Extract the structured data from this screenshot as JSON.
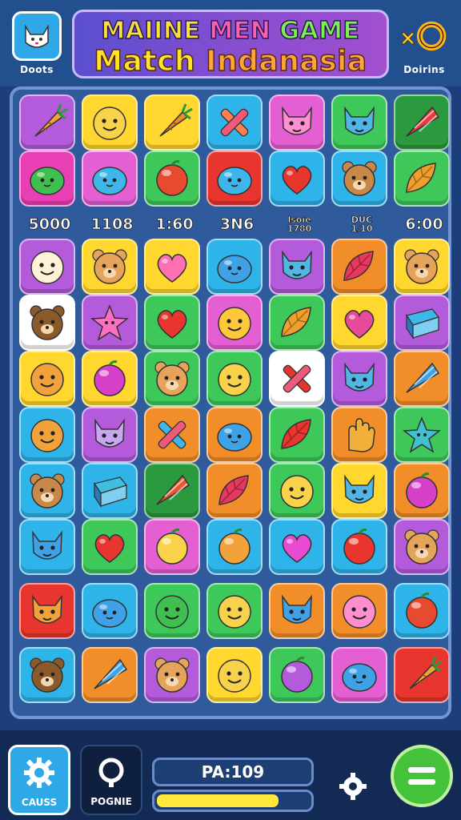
{
  "header": {
    "left_button_label": "Doots",
    "right_button_label": "Doirins",
    "title_line1": [
      "MAIINE",
      "MEN",
      "GAME"
    ],
    "title_line2": [
      "Match",
      "Indanasia"
    ]
  },
  "board": {
    "score_strip": [
      "5000",
      "1108",
      "1:60",
      "3N6",
      "",
      "",
      "6:00"
    ],
    "score_strip_small": [
      {
        "a": "lsoie",
        "b": "1780"
      },
      {
        "a": "DUC",
        "b": "1/10"
      }
    ],
    "mini_note": "",
    "rows": [
      [
        {
          "bg": "#b45bdc",
          "icon": "carrot",
          "color": "#f2a23a",
          "name": "carrot-piece"
        },
        {
          "bg": "#ffd72e",
          "icon": "face",
          "color": "#f7d24a",
          "name": "yellow-face-piece"
        },
        {
          "bg": "#ffd72e",
          "icon": "carrot",
          "color": "#f08a2a",
          "name": "carrot-piece"
        },
        {
          "bg": "#2fb4ea",
          "icon": "cross",
          "color": "#ff7f50",
          "name": "crossed-sticks-piece"
        },
        {
          "bg": "#e45fd2",
          "icon": "cat",
          "color": "#ff8fd1",
          "name": "pink-cat-piece"
        },
        {
          "bg": "#3fc85a",
          "icon": "cat",
          "color": "#4fb6e6",
          "name": "blue-cat-piece"
        },
        {
          "bg": "#2b9a3f",
          "icon": "cone",
          "color": "#e8383f",
          "name": "cone-piece"
        }
      ],
      [
        {
          "bg": "#e83fb4",
          "icon": "blob",
          "color": "#3fbf4f",
          "name": "green-blob-piece"
        },
        {
          "bg": "#e45fd2",
          "icon": "blob",
          "color": "#3fb6ea",
          "name": "blue-blob-piece"
        },
        {
          "bg": "#3fc85a",
          "icon": "ball",
          "color": "#e84a2f",
          "name": "red-ball-piece"
        },
        {
          "bg": "#e8362f",
          "icon": "blob",
          "color": "#3fb6ea",
          "name": "blue-blob-piece"
        },
        {
          "bg": "#2fb4ea",
          "icon": "heart",
          "color": "#e8362f",
          "name": "red-heart-piece"
        },
        {
          "bg": "#2fb4ea",
          "icon": "bear",
          "color": "#c8884a",
          "name": "bear-piece"
        },
        {
          "bg": "#3fc85a",
          "icon": "leaf",
          "color": "#f0a02a",
          "name": "orange-leaf-piece"
        }
      ],
      [
        {
          "bg": "#b45bdc",
          "icon": "face",
          "color": "#fff1d8",
          "name": "white-face-piece"
        },
        {
          "bg": "#ffd72e",
          "icon": "bear",
          "color": "#e6a45a",
          "name": "bear-piece"
        },
        {
          "bg": "#ffd72e",
          "icon": "heart",
          "color": "#ff6fb4",
          "name": "pink-heart-piece"
        },
        {
          "bg": "#2fb4ea",
          "icon": "blob",
          "color": "#3fa2e6",
          "name": "blue-drop-piece"
        },
        {
          "bg": "#b45bdc",
          "icon": "cat",
          "color": "#4fb6e6",
          "name": "blue-cat-piece"
        },
        {
          "bg": "#f28e2a",
          "icon": "leaf",
          "color": "#e8385f",
          "name": "pink-leaf-piece"
        },
        {
          "bg": "#ffd72e",
          "icon": "bear",
          "color": "#e6a45a",
          "name": "bear-piece"
        }
      ],
      [
        {
          "bg": "#ffffff",
          "icon": "bear",
          "color": "#8b5a2b",
          "name": "brown-bear-piece"
        },
        {
          "bg": "#b45bdc",
          "icon": "star",
          "color": "#ff6fc1",
          "name": "pink-star-piece"
        },
        {
          "bg": "#3fc85a",
          "icon": "heart",
          "color": "#e8362f",
          "name": "red-heart-piece"
        },
        {
          "bg": "#e45fd2",
          "icon": "face",
          "color": "#ffc83a",
          "name": "yellow-face-piece"
        },
        {
          "bg": "#3fc85a",
          "icon": "leaf",
          "color": "#f0a02a",
          "name": "orange-leaf-piece"
        },
        {
          "bg": "#ffd72e",
          "icon": "heart",
          "color": "#e84a9a",
          "name": "pink-heart-piece"
        },
        {
          "bg": "#b45bdc",
          "icon": "box",
          "color": "#3fb6ea",
          "name": "box-piece"
        }
      ],
      [
        {
          "bg": "#ffd72e",
          "icon": "face",
          "color": "#f2a23a",
          "name": "orange-face-piece"
        },
        {
          "bg": "#ffd72e",
          "icon": "ball",
          "color": "#d63fc8",
          "name": "purple-ball-piece"
        },
        {
          "bg": "#3fc85a",
          "icon": "bear",
          "color": "#e6a45a",
          "name": "bear-piece"
        },
        {
          "bg": "#3fc85a",
          "icon": "face",
          "color": "#f7d24a",
          "name": "yellow-face-piece"
        },
        {
          "bg": "#ffffff",
          "icon": "cross",
          "color": "#e8362f",
          "name": "crossed-sticks-piece"
        },
        {
          "bg": "#b45bdc",
          "icon": "cat",
          "color": "#4fb6e6",
          "name": "blue-cat-piece"
        },
        {
          "bg": "#f28e2a",
          "icon": "cone",
          "color": "#3fa2e6",
          "name": "cone-piece"
        }
      ],
      [
        {
          "bg": "#2fb4ea",
          "icon": "face",
          "color": "#f2a23a",
          "name": "orange-face-piece"
        },
        {
          "bg": "#b45bdc",
          "icon": "cat",
          "color": "#c9a6f0",
          "name": "purple-cat-piece"
        },
        {
          "bg": "#f28e2a",
          "icon": "cross",
          "color": "#3fb6ea",
          "name": "crossed-sticks-piece"
        },
        {
          "bg": "#f28e2a",
          "icon": "blob",
          "color": "#3fa2e6",
          "name": "blue-drop-piece"
        },
        {
          "bg": "#3fc85a",
          "icon": "leaf",
          "color": "#e8362f",
          "name": "red-leaf-piece"
        },
        {
          "bg": "#f28e2a",
          "icon": "hand",
          "color": "#f2b03a",
          "name": "hand-piece"
        },
        {
          "bg": "#3fc85a",
          "icon": "star",
          "color": "#3fbfd0",
          "name": "teal-star-piece"
        }
      ],
      [
        {
          "bg": "#2fb4ea",
          "icon": "bear",
          "color": "#c8884a",
          "name": "bear-piece"
        },
        {
          "bg": "#2fb4ea",
          "icon": "box",
          "color": "#3fbfe0",
          "name": "box-piece"
        },
        {
          "bg": "#2b9a3f",
          "icon": "cone",
          "color": "#e8562f",
          "name": "cone-piece"
        },
        {
          "bg": "#f28e2a",
          "icon": "leaf",
          "color": "#e8385f",
          "name": "pink-leaf-piece"
        },
        {
          "bg": "#3fc85a",
          "icon": "face",
          "color": "#f7d24a",
          "name": "yellow-face-piece"
        },
        {
          "bg": "#ffd72e",
          "icon": "cat",
          "color": "#4fb6e6",
          "name": "blue-cat-piece"
        },
        {
          "bg": "#f28e2a",
          "icon": "ball",
          "color": "#d63fc8",
          "name": "purple-ball-piece"
        }
      ],
      [
        {
          "bg": "#2fb4ea",
          "icon": "cat",
          "color": "#3fa2e6",
          "name": "blue-cat-piece"
        },
        {
          "bg": "#3fc85a",
          "icon": "heart",
          "color": "#e8362f",
          "name": "red-heart-piece"
        },
        {
          "bg": "#e45fd2",
          "icon": "ball",
          "color": "#f7d24a",
          "name": "yellow-ball-piece"
        },
        {
          "bg": "#2fb4ea",
          "icon": "ball",
          "color": "#f2a23a",
          "name": "orange-ball-piece"
        },
        {
          "bg": "#2fb4ea",
          "icon": "heart",
          "color": "#e84ad2",
          "name": "pink-heart-piece"
        },
        {
          "bg": "#2fb4ea",
          "icon": "ball",
          "color": "#e8362f",
          "name": "red-ball-piece"
        },
        {
          "bg": "#b45bdc",
          "icon": "bear",
          "color": "#e6a45a",
          "name": "bear-piece"
        }
      ],
      [
        {
          "bg": "#e8362f",
          "icon": "cat",
          "color": "#f2a23a",
          "name": "orange-cat-piece"
        },
        {
          "bg": "#2fb4ea",
          "icon": "blob",
          "color": "#3fa2e6",
          "name": "blue-blob-piece"
        },
        {
          "bg": "#3fc85a",
          "icon": "face",
          "color": "#3fbf4f",
          "name": "green-face-piece"
        },
        {
          "bg": "#3fc85a",
          "icon": "face",
          "color": "#f7d24a",
          "name": "yellow-face-piece"
        },
        {
          "bg": "#f28e2a",
          "icon": "cat",
          "color": "#3fa2e6",
          "name": "blue-cat-piece"
        },
        {
          "bg": "#f28e2a",
          "icon": "face",
          "color": "#ff8fd1",
          "name": "pink-face-piece"
        },
        {
          "bg": "#2fb4ea",
          "icon": "ball",
          "color": "#e84a2f",
          "name": "red-ball-piece"
        }
      ],
      [
        {
          "bg": "#2fb4ea",
          "icon": "bear",
          "color": "#8b5a2b",
          "name": "brown-bear-piece"
        },
        {
          "bg": "#f28e2a",
          "icon": "cone",
          "color": "#3fa2e6",
          "name": "cone-piece"
        },
        {
          "bg": "#b45bdc",
          "icon": "bear",
          "color": "#e6a45a",
          "name": "bear-piece"
        },
        {
          "bg": "#ffd72e",
          "icon": "face",
          "color": "#f7d24a",
          "name": "yellow-face-piece"
        },
        {
          "bg": "#3fc85a",
          "icon": "ball",
          "color": "#b45bdc",
          "name": "purple-ball-piece"
        },
        {
          "bg": "#e45fd2",
          "icon": "blob",
          "color": "#3fa2e6",
          "name": "blue-blob-piece"
        },
        {
          "bg": "#e8362f",
          "icon": "carrot",
          "color": "#f2a23a",
          "name": "carrot-piece"
        }
      ]
    ]
  },
  "footer": {
    "left_label": "CAUSS",
    "second_label": "POGNIE",
    "stat_text": "PA:109",
    "progress": 0.8
  }
}
